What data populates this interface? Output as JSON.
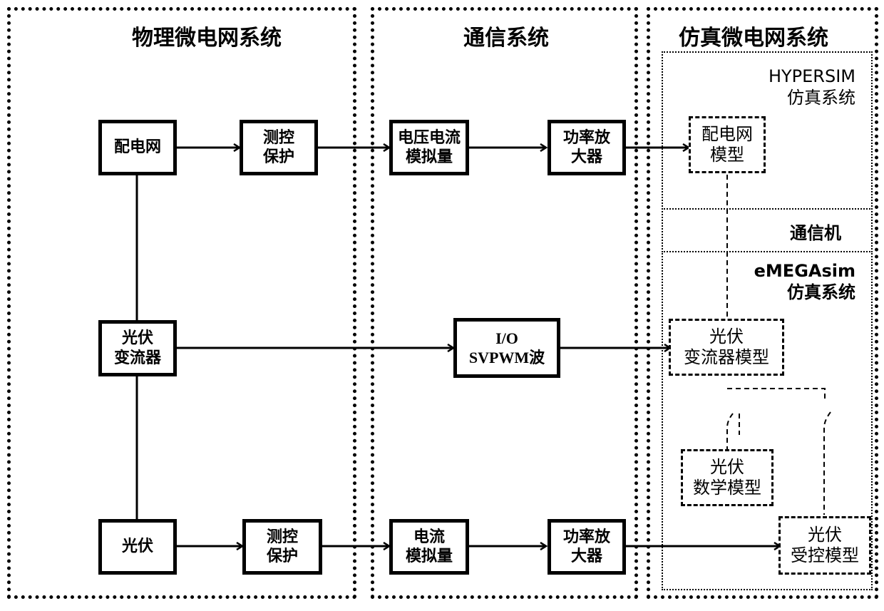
{
  "panels": {
    "physical": {
      "title": "物理微电网系统"
    },
    "communication": {
      "title": "通信系统"
    },
    "simulation": {
      "title": "仿真微电网系统"
    }
  },
  "physical_boxes": {
    "distribution_network": {
      "lines": [
        "配电网"
      ]
    },
    "pv_inverter": {
      "lines": [
        "光伏",
        "变流器"
      ]
    },
    "pv": {
      "lines": [
        "光伏"
      ]
    },
    "protection_top": {
      "lines": [
        "测控",
        "保护"
      ]
    },
    "protection_bottom": {
      "lines": [
        "测控",
        "保护"
      ]
    }
  },
  "comm_boxes": {
    "voltage_current_analog": {
      "lines": [
        "电压电流",
        "模拟量"
      ]
    },
    "power_amp_top": {
      "lines": [
        "功率放",
        "大器"
      ]
    },
    "io_svpwm": {
      "lines": [
        "I/O",
        "SVPWM波"
      ]
    },
    "current_analog": {
      "lines": [
        "电流",
        "模拟量"
      ]
    },
    "power_amp_bottom": {
      "lines": [
        "功率放",
        "大器"
      ]
    }
  },
  "simulation": {
    "hypersim": {
      "lines": [
        "HYPERSIM",
        "仿真系统"
      ]
    },
    "comm_machine": {
      "label": "通信机"
    },
    "emegasim": {
      "lines": [
        "eMEGAsim",
        "仿真系统"
      ]
    },
    "models": {
      "grid_model": {
        "lines": [
          "配电网",
          "模型"
        ]
      },
      "pv_inverter_model": {
        "lines": [
          "光伏",
          "变流器模型"
        ]
      },
      "pv_math_model": {
        "lines": [
          "光伏",
          "数学模型"
        ]
      },
      "pv_controlled_model": {
        "lines": [
          "光伏",
          "受控模型"
        ]
      }
    }
  }
}
